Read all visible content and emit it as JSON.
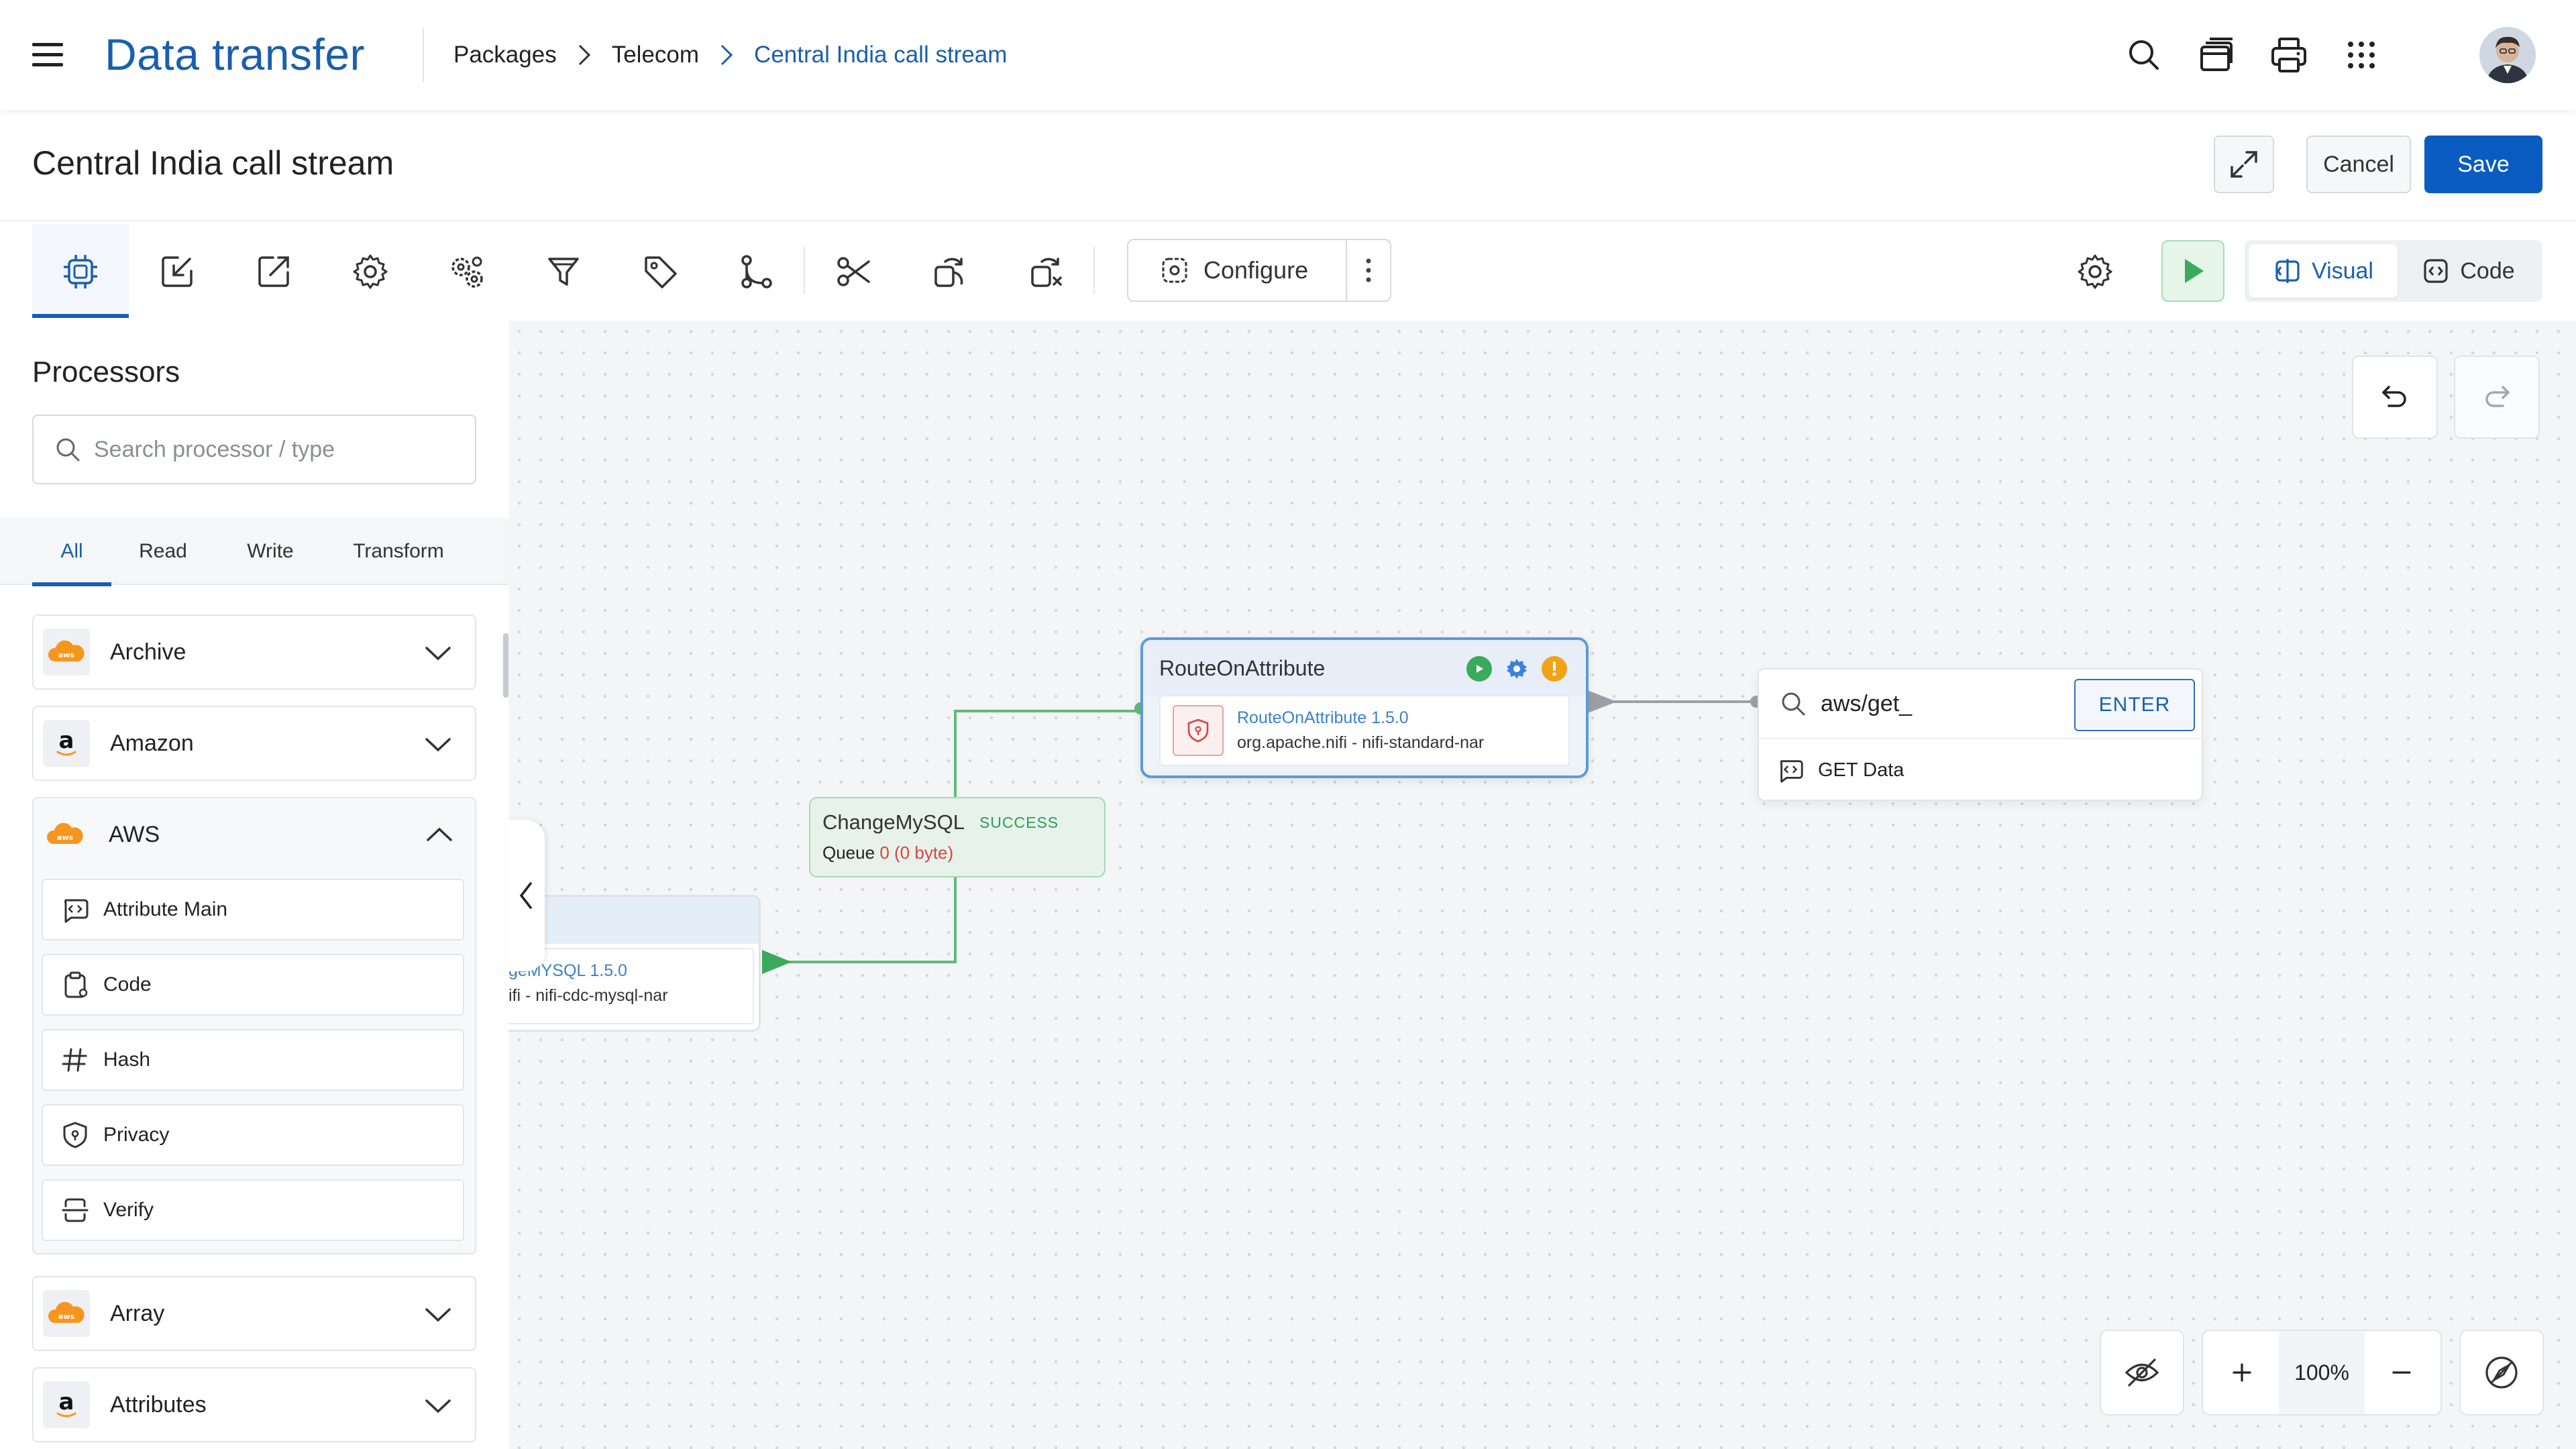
{
  "app": {
    "title": "Data transfer"
  },
  "breadcrumb": [
    "Packages",
    "Telecom",
    "Central India call stream"
  ],
  "header": {
    "page_title": "Central India call stream",
    "cancel_label": "Cancel",
    "save_label": "Save"
  },
  "toolbar": {
    "tools": [
      "processor-icon",
      "import-icon",
      "export-icon",
      "settings-icon",
      "multi-gear-icon",
      "funnel-icon",
      "tag-icon",
      "branch-icon",
      "scissors-icon",
      "copy-icon",
      "duplicate-icon"
    ],
    "configure_label": "Configure",
    "view_visual": "Visual",
    "view_code": "Code",
    "active_view": "Visual"
  },
  "sidebar": {
    "title": "Processors",
    "search_placeholder": "Search processor / type",
    "tabs": [
      "All",
      "Read",
      "Write",
      "Transform"
    ],
    "active_tab": "All",
    "groups": [
      {
        "label": "Archive",
        "icon": "aws-icon",
        "expanded": false
      },
      {
        "label": "Amazon",
        "icon": "amazon-icon",
        "expanded": false
      },
      {
        "label": "AWS",
        "icon": "aws-icon",
        "expanded": true,
        "children": [
          {
            "label": "Attribute Main",
            "icon": "code-bubble-icon"
          },
          {
            "label": "Code",
            "icon": "clipboard-icon"
          },
          {
            "label": "Hash",
            "icon": "hash-icon"
          },
          {
            "label": "Privacy",
            "icon": "shield-icon"
          },
          {
            "label": "Verify",
            "icon": "verify-icon"
          }
        ]
      },
      {
        "label": "Array",
        "icon": "aws-icon",
        "expanded": false
      },
      {
        "label": "Attributes",
        "icon": "amazon-icon",
        "expanded": false
      }
    ]
  },
  "canvas": {
    "route_node": {
      "title": "RouteOnAttribute",
      "version": "RouteOnAttribute 1.5.0",
      "nar": "org.apache.nifi - nifi-standard-nar"
    },
    "change_node": {
      "name": "ChangeMySQL",
      "status": "SUCCESS",
      "queue_label": "Queue",
      "queue_count": "0",
      "queue_size": "(0 byte)"
    },
    "mysql_node": {
      "version": "geMYSQL 1.5.0",
      "nar": "ifi - nifi-cdc-mysql-nar"
    },
    "search_popup": {
      "value": "aws/get_",
      "enter_label": "ENTER",
      "result": "GET Data"
    },
    "zoom": "100%"
  },
  "colors": {
    "brand": "#1a5fad",
    "save": "#0b5cc1",
    "success": "#2e9d57",
    "node_border": "#5b9bd8"
  }
}
